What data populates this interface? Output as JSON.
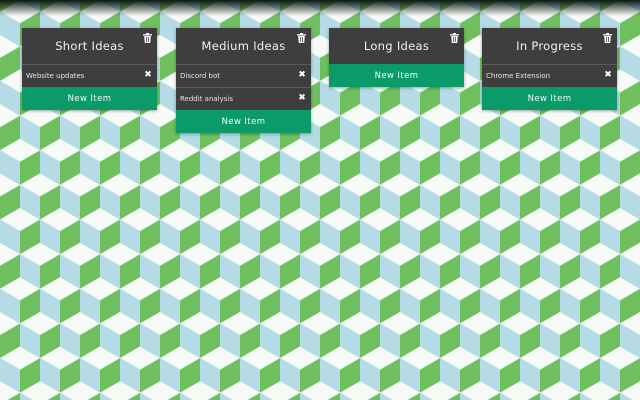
{
  "colors": {
    "column_bg": "#3e3e3e",
    "button_bg": "#0b9b68",
    "bg_green": "#6bbf5a",
    "bg_blue": "#b5dbe6",
    "bg_light": "#ffffff"
  },
  "icons": {
    "delete_column": "trash-icon",
    "remove_item": "close-icon"
  },
  "columns": [
    {
      "title": "Short Ideas",
      "items": [
        "Website updates"
      ],
      "new_item_label": "New Item"
    },
    {
      "title": "Medium Ideas",
      "items": [
        "Discord bot",
        "Reddit analysis"
      ],
      "new_item_label": "New Item"
    },
    {
      "title": "Long Ideas",
      "items": [],
      "new_item_label": "New Item"
    },
    {
      "title": "In Progress",
      "items": [
        "Chrome Extension"
      ],
      "new_item_label": "New Item"
    }
  ]
}
